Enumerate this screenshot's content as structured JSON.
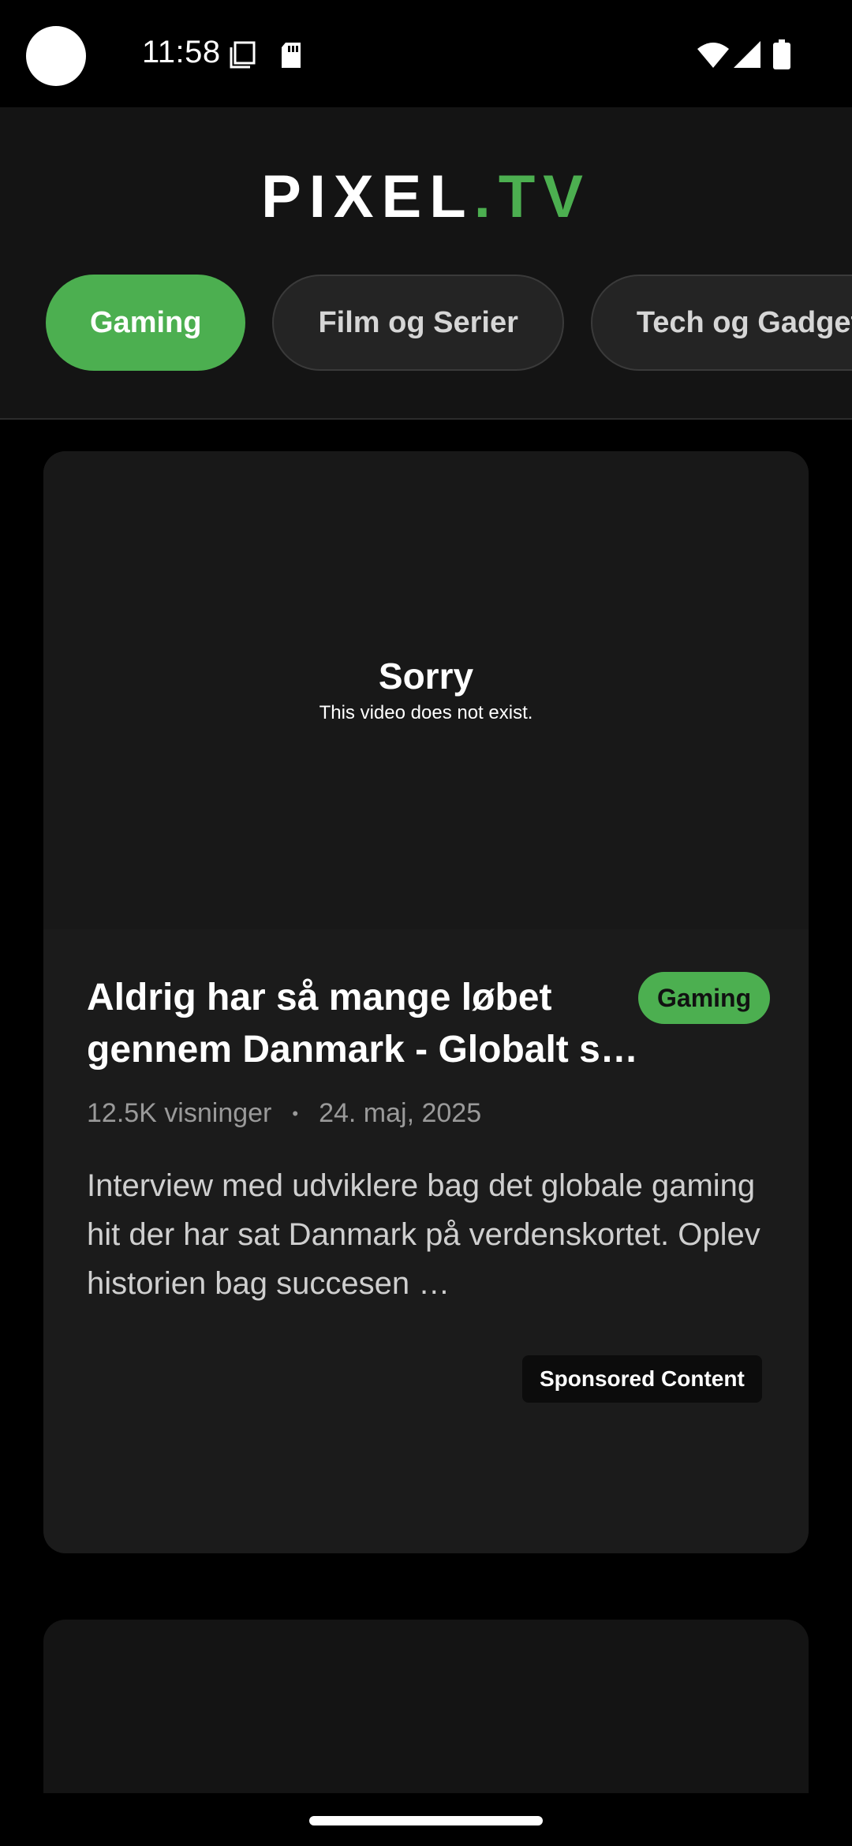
{
  "status_bar": {
    "time": "11:58",
    "icons": [
      "screenshot-icon",
      "sd-card-icon",
      "wifi-icon",
      "signal-icon",
      "battery-icon"
    ]
  },
  "header": {
    "logo_main": "PIXEL",
    "logo_dot": ".",
    "logo_accent": "TV",
    "accent_color": "#4caf50",
    "categories": [
      {
        "label": "Gaming",
        "active": true
      },
      {
        "label": "Film og Serier",
        "active": false
      },
      {
        "label": "Tech og Gadgets",
        "active": false
      }
    ]
  },
  "feed": {
    "card": {
      "video_error_title": "Sorry",
      "video_error_subtitle": "This video does not exist.",
      "title": "Aldrig har så mange løbet gennem Danmark - Globalt s…",
      "badge": "Gaming",
      "views": "12.5K visninger",
      "separator": "•",
      "date": "24. maj, 2025",
      "description": "Interview med udviklere bag det globale gaming hit der har sat Danmark på verdenskortet. Oplev historien bag succesen …",
      "sponsored_label": "Sponsored Content"
    }
  }
}
